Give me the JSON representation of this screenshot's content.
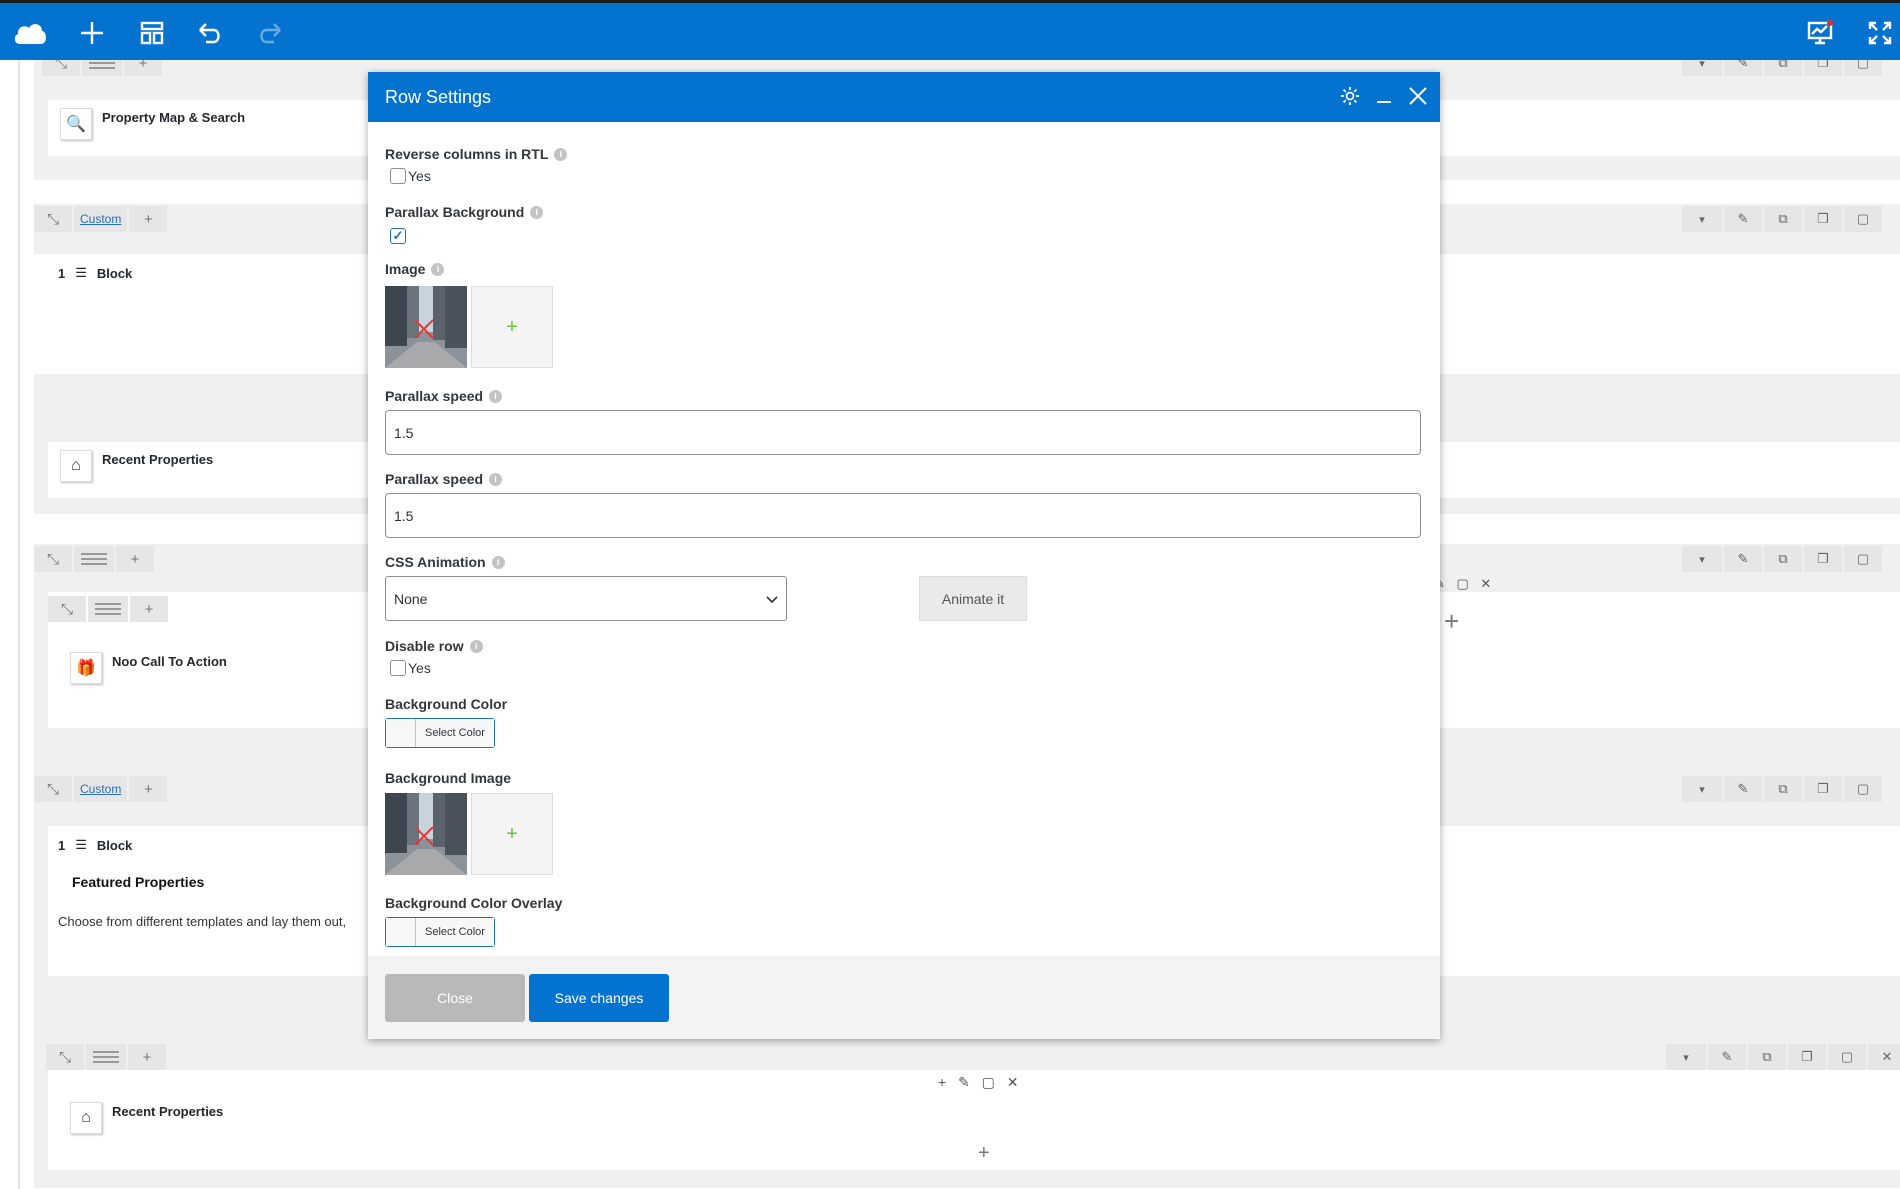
{
  "topbar": {
    "accent": "#0473d0"
  },
  "builder": {
    "elements": {
      "property_map": "Property Map & Search",
      "block1": "Block",
      "recent1": "Recent Properties",
      "call_to_action": "Noo Call To Action",
      "block2": "Block",
      "featured_heading": "Featured Properties",
      "featured_text": "Choose from different templates and lay them out,",
      "recent2": "Recent Properties"
    },
    "custom_label": "Custom",
    "block_count": "1"
  },
  "modal": {
    "title": "Row Settings",
    "fields": {
      "reverse_rtl_label": "Reverse columns in RTL",
      "reverse_rtl_option": "Yes",
      "reverse_rtl_checked": false,
      "parallax_bg_label": "Parallax Background",
      "parallax_bg_checked": true,
      "image_label": "Image",
      "parallax_speed1_label": "Parallax speed",
      "parallax_speed1_value": "1.5",
      "parallax_speed2_label": "Parallax speed",
      "parallax_speed2_value": "1.5",
      "css_animation_label": "CSS Animation",
      "css_animation_value": "None",
      "animate_button": "Animate it",
      "disable_row_label": "Disable row",
      "disable_row_option": "Yes",
      "disable_row_checked": false,
      "bg_color_label": "Background Color",
      "bg_color_button": "Select Color",
      "bg_image_label": "Background Image",
      "bg_overlay_label": "Background Color Overlay",
      "bg_overlay_button": "Select Color"
    },
    "footer": {
      "close": "Close",
      "save": "Save changes"
    }
  }
}
